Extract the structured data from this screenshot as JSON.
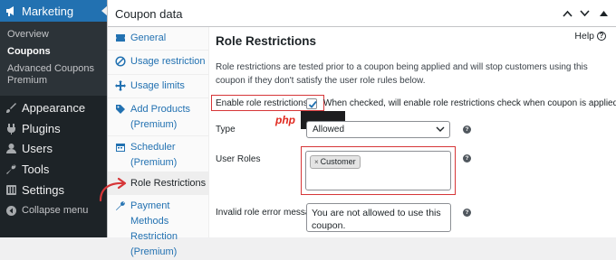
{
  "sidebar": {
    "active": {
      "label": "Marketing",
      "icon": "megaphone-icon"
    },
    "submenu": [
      "Overview",
      "Coupons",
      "Advanced Coupons Premium"
    ],
    "current_submenu": "Coupons",
    "items": [
      {
        "label": "Appearance",
        "icon": "paintbrush-icon"
      },
      {
        "label": "Plugins",
        "icon": "plug-icon"
      },
      {
        "label": "Users",
        "icon": "user-icon"
      },
      {
        "label": "Tools",
        "icon": "wrench-icon"
      },
      {
        "label": "Settings",
        "icon": "settings-icon"
      },
      {
        "label": "Collapse menu",
        "icon": "collapse-icon"
      }
    ]
  },
  "metabox": {
    "title": "Coupon data",
    "tabs": [
      {
        "label": "General",
        "icon": "ticket-icon"
      },
      {
        "label": "Usage restriction",
        "icon": "block-icon"
      },
      {
        "label": "Usage limits",
        "icon": "arrows-icon"
      },
      {
        "label": "Add Products (Premium)",
        "icon": "tag-icon"
      },
      {
        "label": "Scheduler (Premium)",
        "icon": "calendar-icon"
      },
      {
        "label": "Role Restrictions",
        "icon": "none"
      },
      {
        "label": "Payment Methods Restriction (Premium)",
        "icon": "wrench-icon"
      }
    ],
    "active_tab": "Role Restrictions"
  },
  "panel": {
    "title": "Role Restrictions",
    "help_label": "Help",
    "description": "Role restrictions are tested prior to a coupon being applied and will stop customers using this coupon if they don't satisfy the user role rules below.",
    "enable_label": "Enable role restrictions",
    "enable_checked": true,
    "enable_description": "When checked, will enable role restrictions check when coupon is applied",
    "type_label": "Type",
    "type_value": "Allowed",
    "user_roles_label": "User Roles",
    "user_roles": [
      "Customer"
    ],
    "invalid_label": "Invalid role error message",
    "invalid_message": "You are not allowed to use this coupon."
  },
  "watermark": "php",
  "colors": {
    "admin_bar": "#1d2327",
    "accent": "#2271b1",
    "highlight": "#d63638"
  }
}
